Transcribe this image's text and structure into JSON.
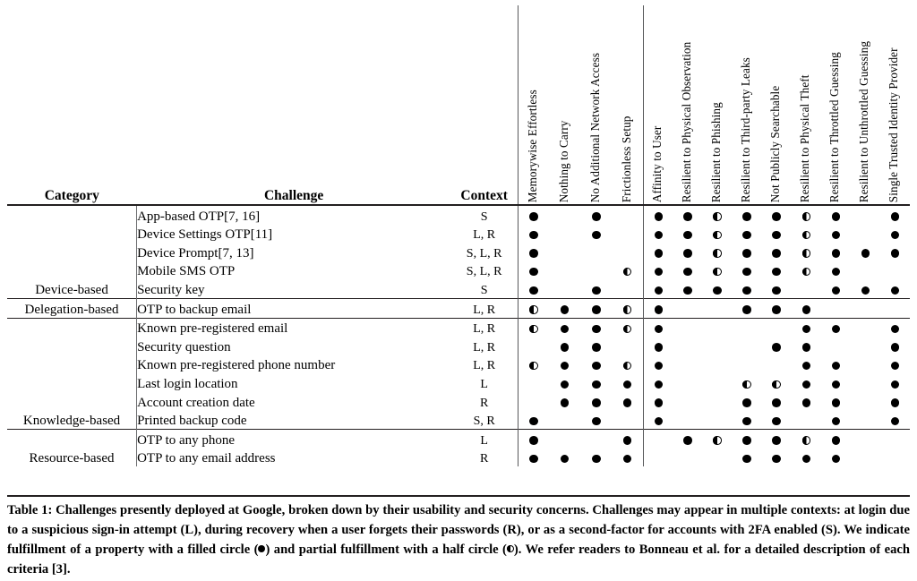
{
  "table": {
    "columns": {
      "category_label": "Category",
      "challenge_label": "Challenge",
      "context_label": "Context",
      "usability": [
        "Memorywise Effortless",
        "Nothing to Carry",
        "No Additional Network Access",
        "Frictionless Setup"
      ],
      "security": [
        "Affinity to User",
        "Resilient to Physical Observation",
        "Resilient to Phishing",
        "Resilient to Third-party Leaks",
        "Not Publicly Searchable",
        "Resilient to Physical Theft",
        "Resilient to Throttled Guessing",
        "Resilient to Unthrottled Guessing",
        "Single Trusted Identity Provider"
      ]
    },
    "legend": {
      "full": "full",
      "half": "half",
      "none": "none"
    },
    "groups": [
      {
        "category": "Device-based",
        "rows": [
          {
            "challenge": "App-based OTP[7, 16]",
            "context": "S",
            "marks": [
              "full",
              "none",
              "full",
              "none",
              "full",
              "full",
              "half",
              "full",
              "full",
              "half",
              "full",
              "none",
              "full"
            ]
          },
          {
            "challenge": "Device Settings OTP[11]",
            "context": "L, R",
            "marks": [
              "full",
              "none",
              "full",
              "none",
              "full",
              "full",
              "half",
              "full",
              "full",
              "half",
              "full",
              "none",
              "full"
            ]
          },
          {
            "challenge": "Device Prompt[7, 13]",
            "context": "S, L, R",
            "marks": [
              "full",
              "none",
              "none",
              "none",
              "full",
              "full",
              "half",
              "full",
              "full",
              "half",
              "full",
              "full",
              "full"
            ]
          },
          {
            "challenge": "Mobile SMS OTP",
            "context": "S, L, R",
            "marks": [
              "full",
              "none",
              "none",
              "half",
              "full",
              "full",
              "half",
              "full",
              "full",
              "half",
              "full",
              "none",
              "none"
            ]
          },
          {
            "challenge": "Security key",
            "context": "S",
            "marks": [
              "full",
              "none",
              "full",
              "none",
              "full",
              "full",
              "full",
              "full",
              "full",
              "none",
              "full",
              "full",
              "full"
            ]
          }
        ]
      },
      {
        "category": "Delegation-based",
        "rows": [
          {
            "challenge": "OTP to backup email",
            "context": "L, R",
            "marks": [
              "half",
              "full",
              "full",
              "half",
              "full",
              "none",
              "none",
              "full",
              "full",
              "full",
              "none",
              "none",
              "none"
            ]
          }
        ]
      },
      {
        "category": "Knowledge-based",
        "rows": [
          {
            "challenge": "Known pre-registered email",
            "context": "L, R",
            "marks": [
              "half",
              "full",
              "full",
              "half",
              "full",
              "none",
              "none",
              "none",
              "none",
              "full",
              "full",
              "none",
              "full"
            ]
          },
          {
            "challenge": "Security question",
            "context": "L, R",
            "marks": [
              "none",
              "full",
              "full",
              "none",
              "full",
              "none",
              "none",
              "none",
              "full",
              "full",
              "none",
              "none",
              "full"
            ]
          },
          {
            "challenge": "Known pre-registered phone number",
            "context": "L, R",
            "marks": [
              "half",
              "full",
              "full",
              "half",
              "full",
              "none",
              "none",
              "none",
              "none",
              "full",
              "full",
              "none",
              "full"
            ]
          },
          {
            "challenge": "Last login location",
            "context": "L",
            "marks": [
              "none",
              "full",
              "full",
              "full",
              "full",
              "none",
              "none",
              "half",
              "half",
              "full",
              "full",
              "none",
              "full"
            ]
          },
          {
            "challenge": "Account creation date",
            "context": "R",
            "marks": [
              "none",
              "full",
              "full",
              "full",
              "full",
              "none",
              "none",
              "full",
              "full",
              "full",
              "full",
              "none",
              "full"
            ]
          },
          {
            "challenge": "Printed backup code",
            "context": "S, R",
            "marks": [
              "full",
              "none",
              "full",
              "none",
              "full",
              "none",
              "none",
              "full",
              "full",
              "none",
              "full",
              "none",
              "full"
            ]
          }
        ]
      },
      {
        "category": "Resource-based",
        "rows": [
          {
            "challenge": "OTP to any phone",
            "context": "L",
            "marks": [
              "full",
              "none",
              "none",
              "full",
              "none",
              "full",
              "half",
              "full",
              "full",
              "half",
              "full",
              "none",
              "none"
            ]
          },
          {
            "challenge": "OTP to any email address",
            "context": "R",
            "marks": [
              "full",
              "full",
              "full",
              "full",
              "none",
              "none",
              "none",
              "full",
              "full",
              "full",
              "full",
              "none",
              "none"
            ]
          }
        ]
      }
    ]
  },
  "caption": {
    "part1": "Table 1: Challenges presently deployed at Google, broken down by their usability and security concerns. Challenges may appear in multiple contexts: at login due to a suspicious sign-in attempt (L), during recovery when a user forgets their passwords (R), or as a second-factor for accounts with 2FA enabled (S). We indicate fulfillment of a property with a filled circle (",
    "part2": ") and partial fulfillment with a half circle (",
    "part3": "). We refer readers to Bonneau et al. for a detailed description of each criteria [3]."
  }
}
